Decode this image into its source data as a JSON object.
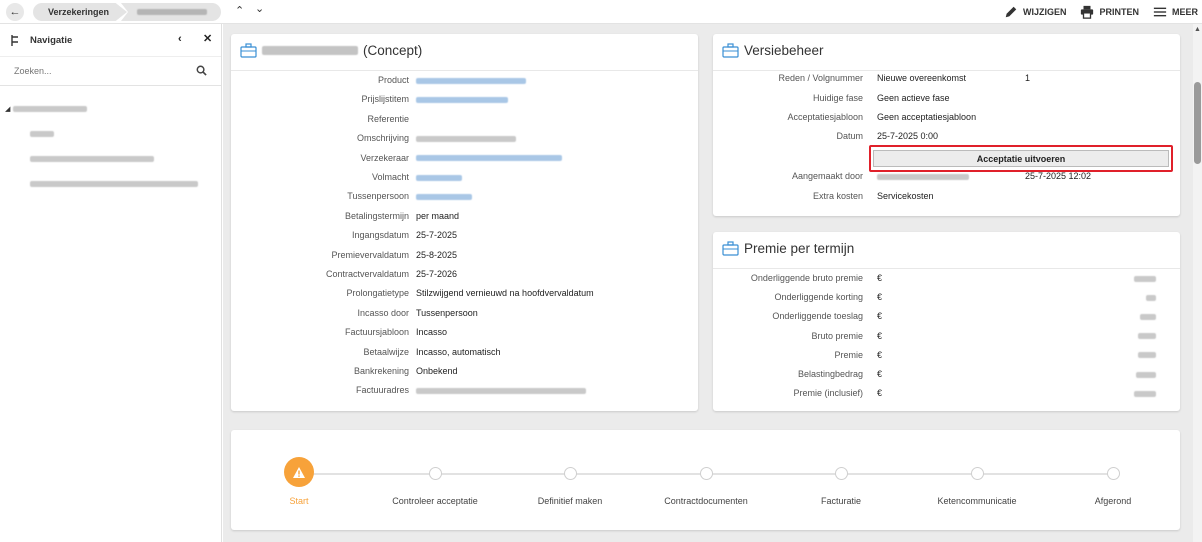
{
  "topbar": {
    "back_icon": "arrow-left-icon",
    "crumb_1": "Verzekeringen",
    "actions": [
      {
        "label": "WIJZIGEN",
        "icon": "pencil-icon"
      },
      {
        "label": "PRINTEN",
        "icon": "printer-icon"
      },
      {
        "label": "MEER",
        "icon": "menu-icon"
      }
    ]
  },
  "sidebar": {
    "title": "Navigatie",
    "search_placeholder": "Zoeken..."
  },
  "polis": {
    "title_suffix": "(Concept)",
    "rows": [
      {
        "label": "Product"
      },
      {
        "label": "Prijslijstitem"
      },
      {
        "label": "Referentie"
      },
      {
        "label": "Omschrijving"
      },
      {
        "label": "Verzekeraar"
      },
      {
        "label": "Volmacht"
      },
      {
        "label": "Tussenpersoon"
      },
      {
        "label": "Betalingstermijn",
        "value": "per maand"
      },
      {
        "label": "Ingangsdatum",
        "value": "25-7-2025"
      },
      {
        "label": "Premievervaldatum",
        "value": "25-8-2025"
      },
      {
        "label": "Contractvervaldatum",
        "value": "25-7-2026"
      },
      {
        "label": "Prolongatietype",
        "value": "Stilzwijgend vernieuwd na hoofdvervaldatum"
      },
      {
        "label": "Incasso door",
        "value": "Tussenpersoon"
      },
      {
        "label": "Factuursjabloon",
        "value": "Incasso"
      },
      {
        "label": "Betaalwijze",
        "value": "Incasso, automatisch"
      },
      {
        "label": "Bankrekening",
        "value": "Onbekend"
      },
      {
        "label": "Factuuradres"
      }
    ]
  },
  "versie": {
    "title": "Versiebeheer",
    "reden_label": "Reden / Volgnummer",
    "reden_value": "Nieuwe overeenkomst",
    "volgnummer": "1",
    "fase_label": "Huidige fase",
    "fase_value": "Geen actieve fase",
    "sjabloon_label": "Acceptatiesjabloon",
    "sjabloon_value": "Geen acceptatiesjabloon",
    "datum_label": "Datum",
    "datum_value": "25-7-2025 0:00",
    "accept_button": "Acceptatie uitvoeren",
    "aangemaakt_label": "Aangemaakt door",
    "aangemaakt_datum": "25-7-2025 12:02",
    "extra_label": "Extra kosten",
    "extra_value": "Servicekosten"
  },
  "premie": {
    "title": "Premie per termijn",
    "currency": "€",
    "rows": [
      {
        "label": "Onderliggende bruto premie"
      },
      {
        "label": "Onderliggende korting"
      },
      {
        "label": "Onderliggende toeslag"
      },
      {
        "label": "Bruto premie"
      },
      {
        "label": "Premie"
      },
      {
        "label": "Belastingbedrag"
      },
      {
        "label": "Premie (inclusief)"
      }
    ]
  },
  "steps": {
    "items": [
      "Start",
      "Controleer acceptatie",
      "Definitief maken",
      "Contractdocumenten",
      "Facturatie",
      "Ketencommunicatie",
      "Afgerond"
    ],
    "active_color": "#f7a23a"
  },
  "colors": {
    "highlight": "#e0202a",
    "accent": "#2e86c1"
  }
}
